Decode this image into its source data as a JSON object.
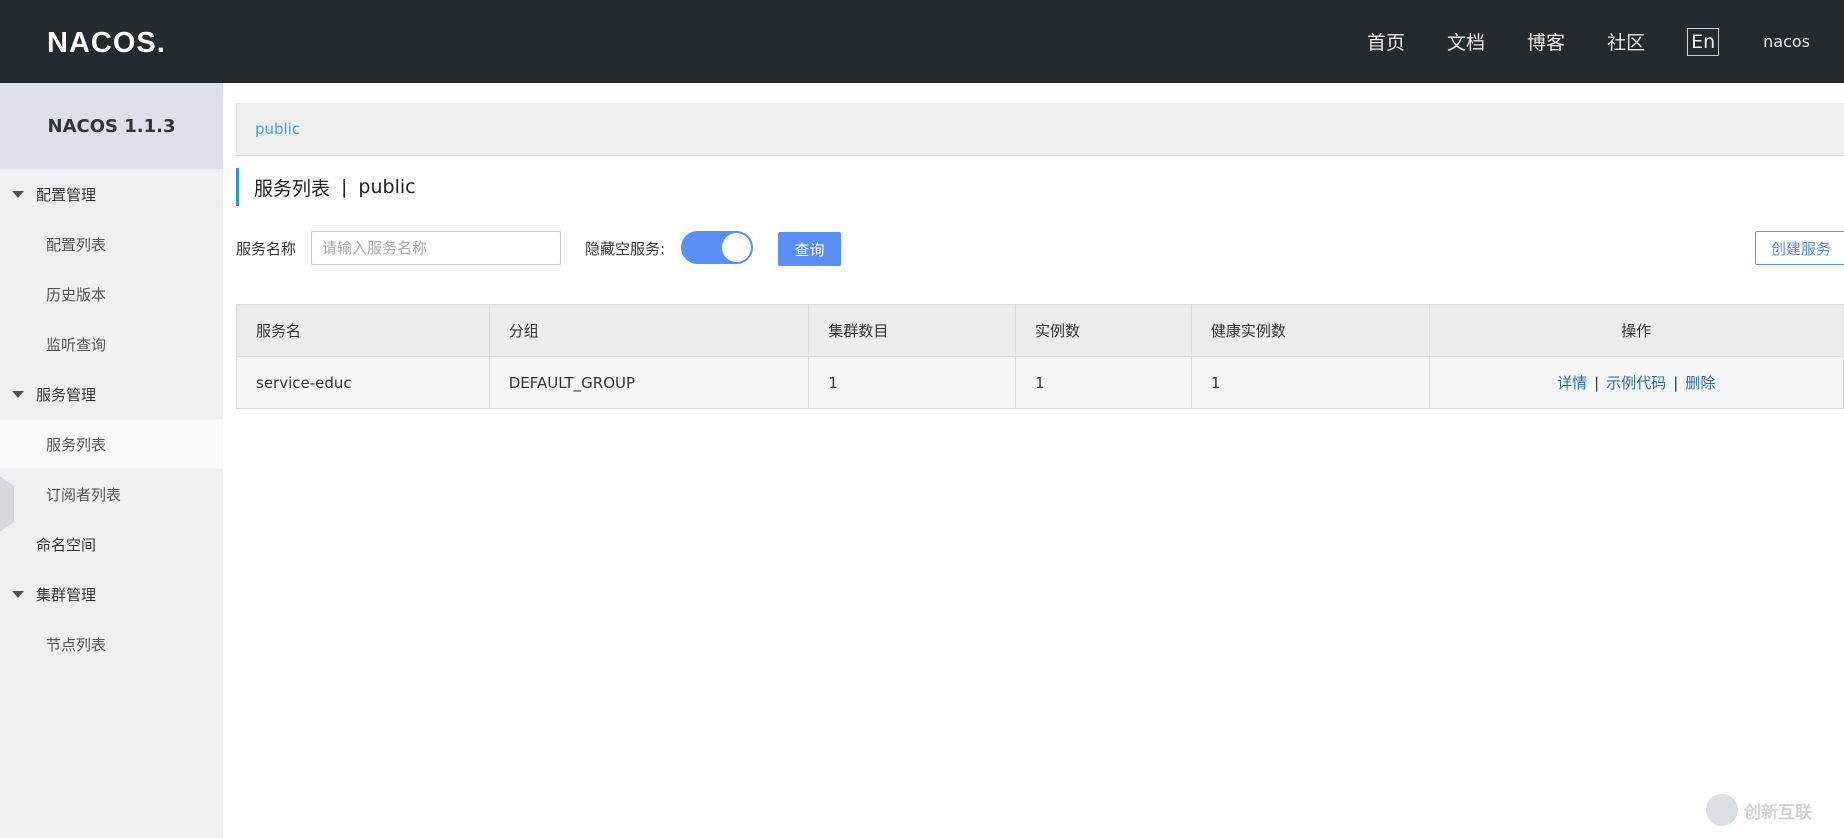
{
  "header": {
    "logo_text": "NACOS.",
    "nav": [
      "首页",
      "文档",
      "博客",
      "社区"
    ],
    "lang": "En",
    "user": "nacos"
  },
  "sidebar": {
    "title": "NACOS 1.1.3",
    "groups": [
      {
        "label": "配置管理",
        "items": [
          "配置列表",
          "历史版本",
          "监听查询"
        ]
      },
      {
        "label": "服务管理",
        "items": [
          "服务列表",
          "订阅者列表"
        ]
      },
      {
        "label": "命名空间"
      },
      {
        "label": "集群管理",
        "items": [
          "节点列表"
        ]
      }
    ],
    "active_item": "服务列表"
  },
  "breadcrumb": {
    "namespace": "public"
  },
  "page": {
    "title": "服务列表",
    "separator": "|",
    "namespace": "public"
  },
  "toolbar": {
    "service_name_label": "服务名称",
    "service_name_placeholder": "请输入服务名称",
    "hide_empty_label": "隐藏空服务:",
    "hide_empty_on": true,
    "query_label": "查询",
    "create_label": "创建服务"
  },
  "table": {
    "headers": [
      "服务名",
      "分组",
      "集群数目",
      "实例数",
      "健康实例数",
      "操作"
    ],
    "rows": [
      {
        "name": "service-educ",
        "group": "DEFAULT_GROUP",
        "clusters": "1",
        "instances": "1",
        "healthy": "1"
      }
    ],
    "actions": {
      "detail": "详情",
      "sample": "示例代码",
      "delete": "删除",
      "sep": "|"
    }
  },
  "watermark": {
    "text": "创新互联"
  },
  "colors": {
    "topbar": "#252a2f",
    "primary": "#5a8ff7",
    "link": "#2d6cb4",
    "breadcrumb_link": "#3ea6d7"
  }
}
